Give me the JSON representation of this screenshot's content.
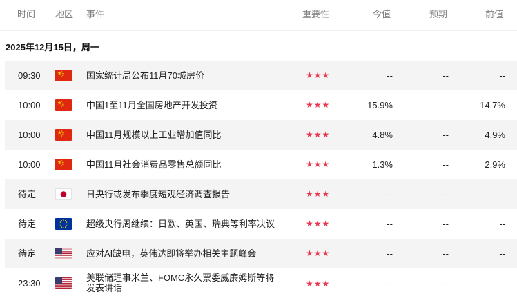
{
  "header": {
    "time": "时间",
    "region": "地区",
    "event": "事件",
    "importance": "重要性",
    "actual": "今值",
    "forecast": "预期",
    "previous": "前值"
  },
  "date_label": "2025年12月15日，周一",
  "colors": {
    "star": "#e7364f",
    "alt_row": "#f4f4f4"
  },
  "rows": [
    {
      "time": "09:30",
      "flag": "china-flag-icon",
      "event": "国家统计局公布11月70城房价",
      "stars": "★★★",
      "actual": "--",
      "forecast": "--",
      "previous": "--"
    },
    {
      "time": "10:00",
      "flag": "china-flag-icon",
      "event": "中国1至11月全国房地产开发投资",
      "stars": "★★★",
      "actual": "-15.9%",
      "forecast": "--",
      "previous": "-14.7%"
    },
    {
      "time": "10:00",
      "flag": "china-flag-icon",
      "event": "中国11月规模以上工业增加值同比",
      "stars": "★★★",
      "actual": "4.8%",
      "forecast": "--",
      "previous": "4.9%"
    },
    {
      "time": "10:00",
      "flag": "china-flag-icon",
      "event": "中国11月社会消费品零售总额同比",
      "stars": "★★★",
      "actual": "1.3%",
      "forecast": "--",
      "previous": "2.9%"
    },
    {
      "time": "待定",
      "flag": "japan-flag-icon",
      "event": "日央行或发布季度短观经济调查报告",
      "stars": "★★★",
      "actual": "--",
      "forecast": "--",
      "previous": "--"
    },
    {
      "time": "待定",
      "flag": "eu-flag-icon",
      "event": "超级央行周继续：日欧、英国、瑞典等利率决议",
      "stars": "★★★",
      "actual": "--",
      "forecast": "--",
      "previous": "--"
    },
    {
      "time": "待定",
      "flag": "us-flag-icon",
      "event": "应对AI缺电，英伟达即将举办相关主题峰会",
      "stars": "★★★",
      "actual": "--",
      "forecast": "--",
      "previous": "--"
    },
    {
      "time": "23:30",
      "flag": "us-flag-icon",
      "event": "美联储理事米兰、FOMC永久票委威廉姆斯等将发表讲话",
      "stars": "★★★",
      "actual": "--",
      "forecast": "--",
      "previous": "--"
    }
  ]
}
